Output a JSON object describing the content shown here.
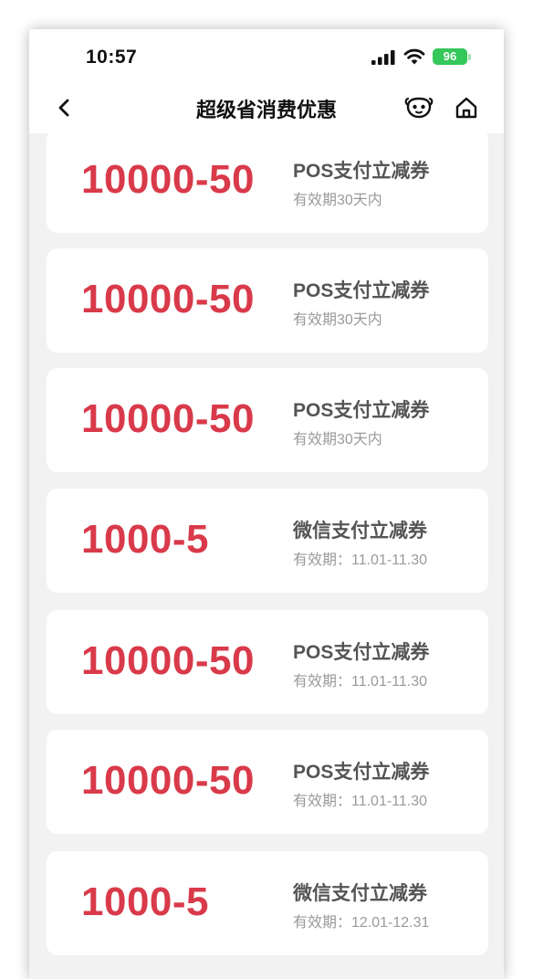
{
  "status_bar": {
    "time": "10:57",
    "battery": "96",
    "battery_color": "#34c759",
    "icons": [
      "signal-icon",
      "wifi-icon",
      "battery-icon"
    ]
  },
  "nav": {
    "title": "超级省消费优惠",
    "icons": [
      "back-icon",
      "mini-program-icon",
      "home-icon"
    ]
  },
  "colors": {
    "amount": "#d93a4a",
    "name": "#555555",
    "validity": "#9a9a9a",
    "background": "#f2f2f2",
    "card": "#ffffff"
  },
  "coupons": [
    {
      "amount": "10000-50",
      "name": "POS支付立减券",
      "validity": "有效期30天内"
    },
    {
      "amount": "10000-50",
      "name": "POS支付立减券",
      "validity": "有效期30天内"
    },
    {
      "amount": "10000-50",
      "name": "POS支付立减券",
      "validity": "有效期30天内"
    },
    {
      "amount": "1000-5",
      "name": "微信支付立减券",
      "validity": "有效期：11.01-11.30"
    },
    {
      "amount": "10000-50",
      "name": "POS支付立减券",
      "validity": "有效期：11.01-11.30"
    },
    {
      "amount": "10000-50",
      "name": "POS支付立减券",
      "validity": "有效期：11.01-11.30"
    },
    {
      "amount": "1000-5",
      "name": "微信支付立减券",
      "validity": "有效期：12.01-12.31"
    }
  ]
}
